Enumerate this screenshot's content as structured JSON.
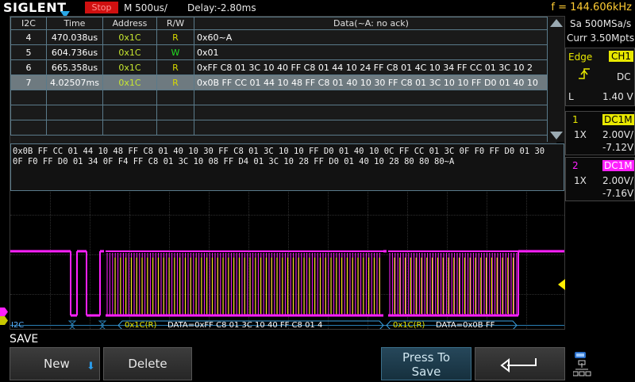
{
  "topbar": {
    "logo": "SIGLENT",
    "status": "Stop",
    "timebase": "M 500us/",
    "delay": "Delay:-2.80ms",
    "frequency": "f = 144.606kHz"
  },
  "event_table": {
    "columns": [
      "I2C",
      "Time",
      "Address",
      "R/W",
      "Data(~A: no ack)"
    ],
    "rows": [
      {
        "index": "4",
        "time": "470.038us",
        "address": "0x1C",
        "rw": "R",
        "data": "0x60~A"
      },
      {
        "index": "5",
        "time": "604.736us",
        "address": "0x1C",
        "rw": "W",
        "data": "0x01"
      },
      {
        "index": "6",
        "time": "665.358us",
        "address": "0x1C",
        "rw": "R",
        "data": "0xFF C8 01 3C 10 40 FF C8 01 44 10 24 FF C8 01 4C 10 34 FF CC 01 3C 10 2"
      },
      {
        "index": "7",
        "time": "4.02507ms",
        "address": "0x1C",
        "rw": "R",
        "data": "0x0B FF CC 01 44 10 48 FF C8 01 40 10 30 FF C8 01 3C 10 10 FF D0 01 40 10"
      }
    ],
    "selected_index": "7"
  },
  "detail": {
    "line1": "0x0B FF CC 01 44 10 48 FF C8 01 40 10 30 FF C8 01 3C 10 10 FF D0 01 40 10 0C FF CC 01 3C 0F F0 FF D0 01 30",
    "line2": "0F F0 FF D0 01 34 0F F4 FF C8 01 3C 10 08 FF D4 01 3C 10 28 FF D0 01 40 10 28 80 80 80~A"
  },
  "decode_bar": {
    "label": "I2C",
    "frame1": "0x1C(R)",
    "frame1_data": "DATA=0xFF C8 01 3C 10 40 FF C8 01 4",
    "frame2": "0x1C(R)",
    "frame2_data": "DATA=0x0B FF"
  },
  "right_panel": {
    "sample_rate": "Sa 500MSa/s",
    "memory": "Curr 3.50Mpts",
    "trigger_type": "Edge",
    "trigger_source": "CH1",
    "trigger_coupling": "DC",
    "trigger_level_label": "L",
    "trigger_level": "1.40 V",
    "ch1": {
      "number": "1",
      "coupling": "DC1M",
      "probe": "1X",
      "scale": "2.00V/",
      "offset": "-7.12V",
      "color": "#ffff00"
    },
    "ch2": {
      "number": "2",
      "coupling": "DC1M",
      "probe": "1X",
      "scale": "2.00V/",
      "offset": "-7.16V",
      "color": "#ff20ff"
    }
  },
  "menu": {
    "title": "SAVE",
    "new_label": "New",
    "delete_label": "Delete",
    "press_to_save_line1": "Press To",
    "press_to_save_line2": "Save"
  },
  "colors": {
    "ch1": "#ffff00",
    "ch2": "#ff20ff",
    "accent_frequency": "#ffcc33",
    "stop_badge": "#d01010"
  },
  "icons": [
    "trigger-rising-edge-icon",
    "back-arrow-icon",
    "usb-network-icon",
    "down-arrow-icon"
  ]
}
